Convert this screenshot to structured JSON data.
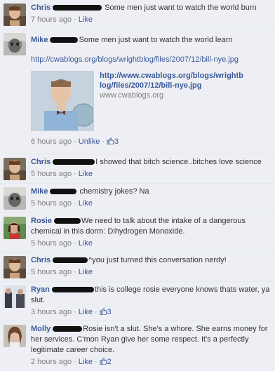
{
  "comments": [
    {
      "author": "Chris",
      "text": "Some men just want to watch the world burn",
      "time": "7 hours ago",
      "like": "Like"
    },
    {
      "author": "Mike",
      "text": "Some men just want to watch the world learn",
      "url": "http://cwablogs.org/blogs/wrightblog/files/2007/12/bill-nye.jpg",
      "attachment_title": "http://www.cwablogs.org/blogs/wrightblog/files/2007/12/bill-nye.jpg",
      "attachment_domain": "www.cwablogs.org",
      "time": "6 hours ago",
      "like": "Unlike",
      "likes": "3"
    },
    {
      "author": "Chris",
      "text": "I showed that bitch science..bitches love science",
      "time": "5 hours ago",
      "like": "Like"
    },
    {
      "author": "Mike",
      "text": "chemistry jokes? Na",
      "time": "5 hours ago",
      "like": "Like"
    },
    {
      "author": "Rosie",
      "text": "We need to talk about the intake of a dangerous chemical in this dorm: Dihydrogen Monoxide.",
      "time": "5 hours ago",
      "like": "Like"
    },
    {
      "author": "Chris",
      "text": "^you just turned this conversation nerdy!",
      "time": "5 hours ago",
      "like": "Like"
    },
    {
      "author": "Ryan",
      "text": "this is college rosie everyone knows thats water, ya slut.",
      "time": "3 hours ago",
      "like": "Like",
      "likes": "3"
    },
    {
      "author": "Molly",
      "text": "Rosie isn't a slut. She's a whore. She earns money for her services. C'mon Ryan give her some respect. It's a perfectly legitimate career choice.",
      "time": "2 hours ago",
      "like": "Like",
      "likes": "2"
    }
  ],
  "separator": "·",
  "colors": {
    "background": "#edeff4",
    "author_link": "#3b5998",
    "meta_text": "#808080",
    "redaction": "#111111"
  },
  "icons": {
    "thumbs_up": "thumbs-up-icon"
  }
}
